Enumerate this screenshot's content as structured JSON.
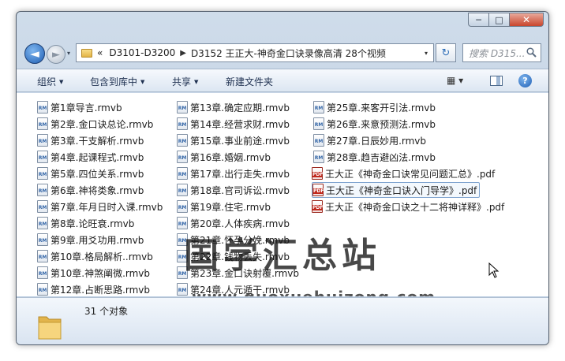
{
  "window": {
    "controls": {
      "minimize": "─",
      "maximize": "□",
      "close": "✕"
    }
  },
  "nav": {
    "back_glyph": "◄",
    "forward_glyph": "►",
    "history_glyph": "▾",
    "breadcrumb_prefix": "«",
    "breadcrumb": [
      "D3101-D3200",
      "D3152 王正大-神奇金口诀录像高清 28个视频"
    ],
    "crumb_sep": "▶",
    "dropdown_glyph": "▾",
    "refresh_glyph": "↻",
    "search_placeholder": "搜索 D315..."
  },
  "toolbar": {
    "organize": "组织",
    "include_in_library": "包含到库中",
    "share": "共享",
    "new_folder": "新建文件夹",
    "arrow": "▼",
    "view_glyph": "▦ ▾",
    "help_glyph": "?"
  },
  "file_icons": {
    "video": "RM",
    "pdf": "PDF"
  },
  "files": {
    "col1": [
      "第1章导言.rmvb",
      "第2章.金口诀总论.rmvb",
      "第3章.干支解析.rmvb",
      "第4章.起课程式.rmvb",
      "第5章.四位关系.rmvb",
      "第6章.神将类象.rmvb",
      "第7章.年月日时入课.rmvb",
      "第8章.论旺衰.rmvb",
      "第9章.用爻功用.rmvb",
      "第10章.格局解析..rmvb",
      "第10章.神煞阐微.rmvb",
      "第12章.占断思路.rmvb"
    ],
    "col2": [
      "第13章.确定应期.rmvb",
      "第14章.经营求财.rmvb",
      "第15章.事业前途.rmvb",
      "第16章.婚姻.rmvb",
      "第17章.出行走失.rmvb",
      "第18章.官司诉讼.rmvb",
      "第19章.住宅.rmvb",
      "第20章.人体疾病.rmvb",
      "第21章.怀孕分娩.rmvb",
      "第22章.钱物丢失.rmvb",
      "第23章.金口诀射覆.rmvb",
      "第24章.人元遁干.rmvb"
    ],
    "col3": [
      "第25章.来客开引法.rmvb",
      "第26章.来意预测法.rmvb",
      "第27章.日辰妙用.rmvb",
      "第28章.趋吉避凶法.rmvb"
    ],
    "pdfs": [
      "王大正《神奇金口诀常见问题汇总》.pdf",
      "王大正《神奇金口诀入门导学》.pdf",
      "王大正《神奇金口诀之十二将神详释》.pdf"
    ]
  },
  "watermark": {
    "text": "国学汇总站",
    "url": "www.guoxuehuizong.com"
  },
  "status": {
    "count": "31 个对象"
  }
}
